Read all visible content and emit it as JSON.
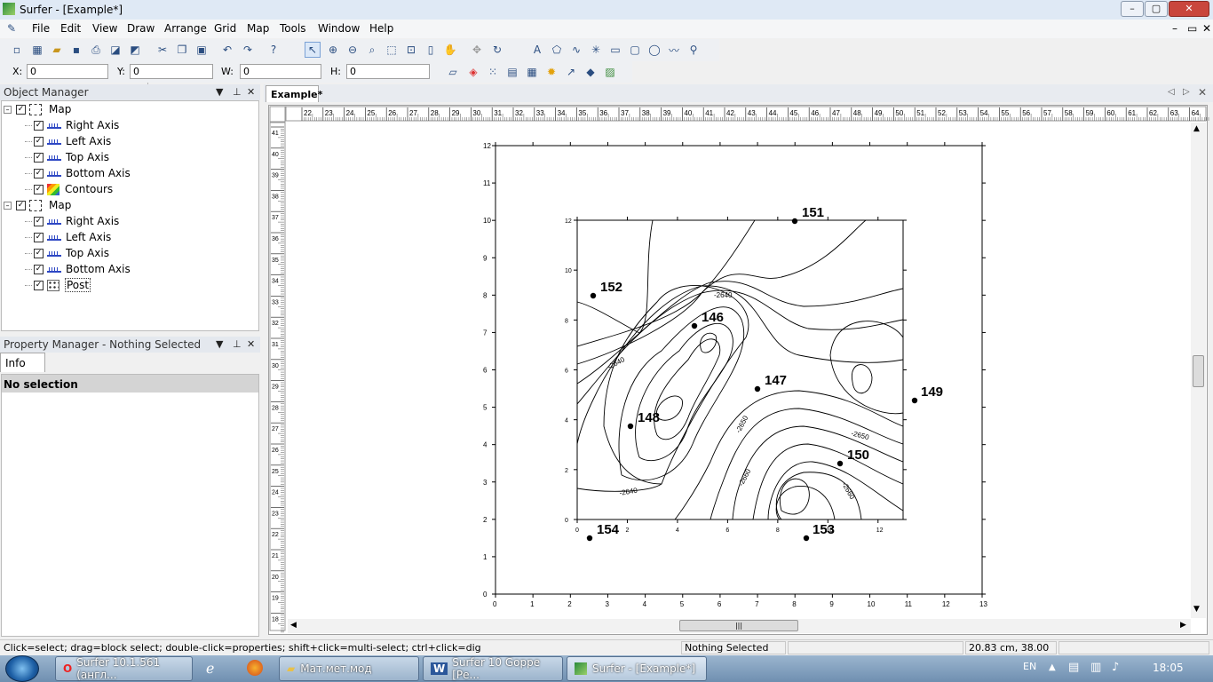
{
  "window": {
    "title": "Surfer - [Example*]",
    "minimize": "–",
    "maximize": "▢",
    "close": "✕"
  },
  "menu": [
    "File",
    "Edit",
    "View",
    "Draw",
    "Arrange",
    "Grid",
    "Map",
    "Tools",
    "Window",
    "Help"
  ],
  "mdi_controls": [
    "–",
    "▭",
    "✕"
  ],
  "coords": {
    "x_label": "X:",
    "x_value": "0",
    "y_label": "Y:",
    "y_value": "0",
    "w_label": "W:",
    "w_value": "0",
    "h_label": "H:",
    "h_value": "0"
  },
  "object_manager": {
    "title": "Object Manager",
    "tree": [
      {
        "label": "Map",
        "kind": "map",
        "level": 0
      },
      {
        "label": "Right Axis",
        "kind": "axis",
        "level": 1
      },
      {
        "label": "Left Axis",
        "kind": "axis",
        "level": 1
      },
      {
        "label": "Top Axis",
        "kind": "axis",
        "level": 1
      },
      {
        "label": "Bottom Axis",
        "kind": "axis",
        "level": 1
      },
      {
        "label": "Contours",
        "kind": "contours",
        "level": 1
      },
      {
        "label": "Map",
        "kind": "map",
        "level": 0
      },
      {
        "label": "Right Axis",
        "kind": "axis",
        "level": 1
      },
      {
        "label": "Left Axis",
        "kind": "axis",
        "level": 1
      },
      {
        "label": "Top Axis",
        "kind": "axis",
        "level": 1
      },
      {
        "label": "Bottom Axis",
        "kind": "axis",
        "level": 1
      },
      {
        "label": "Post",
        "kind": "post",
        "level": 1
      }
    ]
  },
  "property_manager": {
    "title": "Property Manager - Nothing Selected",
    "tab": "Info",
    "message": "No selection"
  },
  "document_tab": "Example*",
  "ruler": {
    "h_labels": [
      "22",
      "23",
      "24",
      "25",
      "26",
      "27",
      "28",
      "29",
      "30",
      "31",
      "32",
      "33",
      "34",
      "35",
      "36",
      "37",
      "38",
      "39",
      "40",
      "41",
      "42",
      "43",
      "44",
      "45",
      "46",
      "47",
      "48",
      "49",
      "50",
      "51",
      "52",
      "53",
      "54",
      "55",
      "56",
      "57",
      "58",
      "59",
      "60",
      "61",
      "62",
      "63",
      "64"
    ],
    "v_labels": [
      "41",
      "40",
      "39",
      "38",
      "37",
      "36",
      "35",
      "34",
      "33",
      "32",
      "31",
      "30",
      "29",
      "28",
      "27",
      "26",
      "25",
      "24",
      "23",
      "22",
      "21",
      "20",
      "19",
      "18"
    ]
  },
  "outer_map": {
    "x_ticks": [
      "0",
      "1",
      "2",
      "3",
      "4",
      "5",
      "6",
      "7",
      "8",
      "9",
      "10",
      "11",
      "12",
      "13"
    ],
    "y_ticks": [
      "0",
      "1",
      "2",
      "3",
      "4",
      "5",
      "6",
      "7",
      "8",
      "9",
      "10",
      "11",
      "12"
    ]
  },
  "inner_map": {
    "x_ticks": [
      "0",
      "2",
      "4",
      "6",
      "8",
      "10",
      "12"
    ],
    "y_ticks": [
      "0",
      "2",
      "4",
      "6",
      "8",
      "10",
      "12"
    ],
    "contour_labels": [
      "-2640",
      "-2640",
      "-2640",
      "-2640",
      "-2650",
      "-2650",
      "-2660",
      "-2660"
    ]
  },
  "post_points": [
    {
      "label": "151"
    },
    {
      "label": "152"
    },
    {
      "label": "146"
    },
    {
      "label": "147"
    },
    {
      "label": "149"
    },
    {
      "label": "148"
    },
    {
      "label": "150"
    },
    {
      "label": "154"
    },
    {
      "label": "153"
    }
  ],
  "status": {
    "hint": "Click=select; drag=block select; double-click=properties; shift+click=multi-select; ctrl+click=dig",
    "selection": "Nothing Selected",
    "position": "20.83 cm, 38.00 cm"
  },
  "taskbar": {
    "tasks": [
      "Surfer 10.1.561 (англ...",
      "Мат.мет.мод",
      "Surfer 10 Goppe [Ре...",
      "Surfer - [Example*]"
    ],
    "lang": "EN",
    "time": "18:05"
  }
}
